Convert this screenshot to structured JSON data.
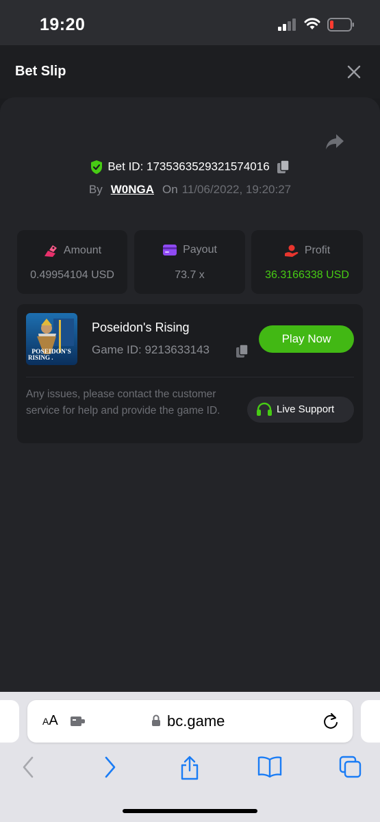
{
  "status_bar": {
    "time": "19:20"
  },
  "header": {
    "title": "Bet Slip"
  },
  "bet": {
    "bet_id_label": "Bet ID: 1735363529321574016",
    "by_label": "By",
    "username": "W0NGA",
    "on_label": "On",
    "datetime": "11/06/2022, 19:20:27"
  },
  "stats": [
    {
      "label": "Amount",
      "value": "0.49954104 USD",
      "icon": "amount-icon",
      "color": "#e8306b"
    },
    {
      "label": "Payout",
      "value": "73.7 x",
      "icon": "card-icon",
      "color": "#8f4af2"
    },
    {
      "label": "Profit",
      "value": "36.3166338 USD",
      "icon": "profit-hand-icon",
      "color": "#e8352e"
    }
  ],
  "game": {
    "name": "Poseidon's Rising",
    "game_id_label": "Game ID: 9213633143",
    "thumb_text_line1": "POSEIDON'S",
    "thumb_text_line2": "RISING .",
    "play_label": "Play Now",
    "support_text": "Any issues, please contact the customer service for help and provide the game ID.",
    "live_support_label": "Live Support"
  },
  "browser": {
    "text_size_label_small": "A",
    "text_size_label_large": "A",
    "url": "bc.game"
  },
  "colors": {
    "accent_green": "#42b814",
    "profit_green": "#47cc14",
    "safari_blue": "#1a7cf5"
  }
}
